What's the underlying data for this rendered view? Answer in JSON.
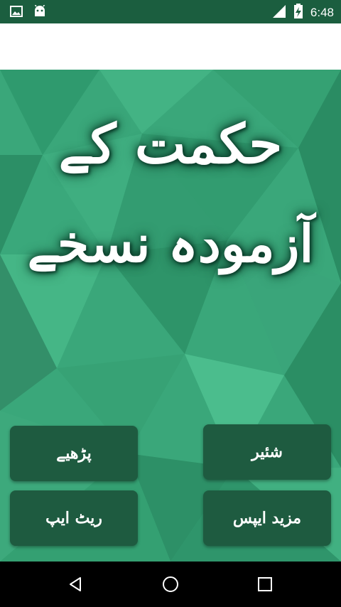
{
  "status_bar": {
    "time": "6:48",
    "icons": [
      "image-icon",
      "android-icon",
      "signal-icon",
      "battery-charging-icon"
    ]
  },
  "title": {
    "line1": "حکمت کے",
    "line2": "آزمودہ نسخے"
  },
  "buttons": {
    "read": "پڑھیے",
    "share": "شئیر",
    "rate_app": "ریٹ ایپ",
    "more_apps": "مزید ایپس"
  },
  "colors": {
    "status_bar": "#1b5e3f",
    "background": "#3aa77a",
    "button": "#1e5b40"
  },
  "nav_bar": {
    "icons": [
      "back-icon",
      "home-icon",
      "recents-icon"
    ]
  }
}
